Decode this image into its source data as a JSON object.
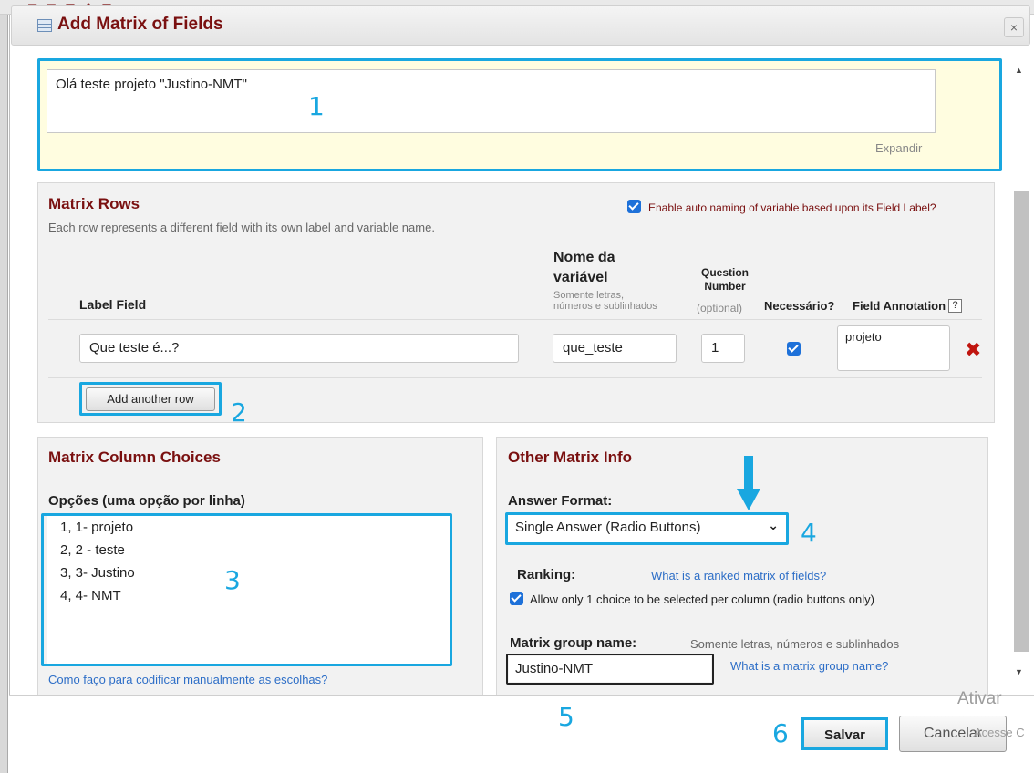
{
  "dialog": {
    "title": "Add Matrix of Fields",
    "close_symbol": "×",
    "section_header_text": "Olá teste projeto \"Justino-NMT\"",
    "expand_link": "Expandir"
  },
  "matrix_rows": {
    "title": "Matrix Rows",
    "subtitle": "Each row represents a different field with its own label and variable name.",
    "auto_naming_label": "Enable auto naming of variable based upon its Field Label?",
    "auto_naming_checked": true,
    "columns": {
      "label_field": "Label Field",
      "var_name": "Nome da variável",
      "var_hint_1": "Somente letras,",
      "var_hint_2": "números e sublinhados",
      "question_number": "Question Number",
      "question_optional": "(optional)",
      "required": "Necessário?",
      "field_annotation": "Field Annotation",
      "help_symbol": "?"
    },
    "rows": [
      {
        "label": "Que teste  é...?",
        "var_name": "que_teste",
        "question_number": "1",
        "required": true,
        "annotation": "projeto",
        "delete_symbol": "✖"
      }
    ],
    "add_row_button": "Add another row"
  },
  "column_choices": {
    "title": "Matrix Column Choices",
    "options_label": "Opções (uma opção por linha)",
    "choices": [
      "1, 1- projeto",
      "2, 2 - teste",
      "3, 3- Justino",
      "4, 4- NMT"
    ],
    "manual_link": "Como faço para codificar manualmente as escolhas?"
  },
  "other_info": {
    "title": "Other Matrix Info",
    "answer_format_label": "Answer Format:",
    "answer_format_value": "Single Answer (Radio Buttons)",
    "ranking_label": "Ranking:",
    "ranking_link": "What is a ranked matrix of fields?",
    "ranking_option": "Allow only 1 choice to be selected per column (radio buttons only)",
    "ranking_checked": true,
    "group_name_label": "Matrix group name:",
    "group_name_hint": "Somente letras, números e sublinhados",
    "group_name_value": "Justino-NMT",
    "group_name_link": "What is a matrix group name?"
  },
  "footer": {
    "save_button": "Salvar",
    "cancel_button": "Cancelar",
    "watermark_title": "Ativar",
    "watermark_sub": "Acesse C"
  },
  "annotations": [
    "1",
    "2",
    "3",
    "4",
    "5",
    "6"
  ],
  "background": {
    "toolbar_glyphs": "▣ ▤ ▥ ✿ ▦"
  },
  "colors": {
    "annotation": "#19a7e0",
    "header_text": "#7a1010",
    "link": "#2d6ec7",
    "checkbox": "#1e71d9",
    "delete": "#c0150f"
  }
}
